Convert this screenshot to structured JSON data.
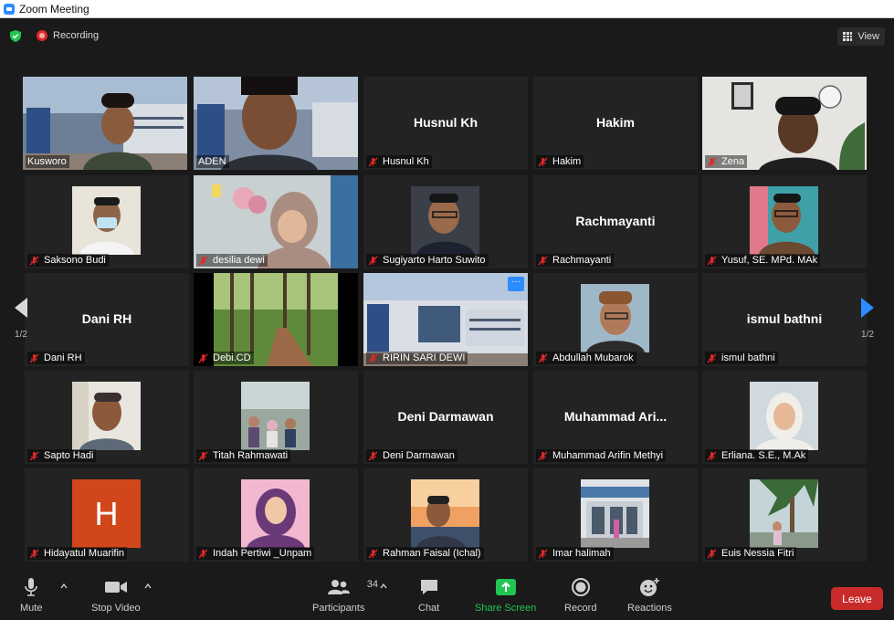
{
  "window": {
    "title": "Zoom Meeting"
  },
  "topbar": {
    "recording_label": "Recording",
    "view_label": "View"
  },
  "gallery": {
    "page_left": "1/2",
    "page_right": "1/2",
    "tiles": [
      {
        "name": "Kusworo",
        "big": ""
      },
      {
        "name": "ADEN",
        "big": ""
      },
      {
        "name": "Husnul Kh",
        "big": "Husnul Kh"
      },
      {
        "name": "Hakim",
        "big": "Hakim"
      },
      {
        "name": "Zena",
        "big": ""
      },
      {
        "name": "Saksono Budi",
        "big": ""
      },
      {
        "name": "desilia dewi",
        "big": ""
      },
      {
        "name": "Sugiyarto Harto Suwito",
        "big": ""
      },
      {
        "name": "Rachmayanti",
        "big": "Rachmayanti"
      },
      {
        "name": "Yusuf, SE. MPd. MAk",
        "big": ""
      },
      {
        "name": "Dani RH",
        "big": "Dani RH"
      },
      {
        "name": "Debi.CD",
        "big": ""
      },
      {
        "name": "RIRIN SARI DEWI",
        "big": ""
      },
      {
        "name": "Abdullah Mubarok",
        "big": ""
      },
      {
        "name": "ismul bathni",
        "big": "ismul bathni"
      },
      {
        "name": "Sapto Hadi",
        "big": ""
      },
      {
        "name": "Titah Rahmawati",
        "big": ""
      },
      {
        "name": "Deni Darmawan",
        "big": "Deni Darmawan"
      },
      {
        "name": "Muhammad Arifin Methyi",
        "big": "Muhammad  Ari..."
      },
      {
        "name": "Erliana. S.E., M.Ak",
        "big": ""
      },
      {
        "name": "Hidayatul Muarifin",
        "big": "",
        "avatar_letter": "H"
      },
      {
        "name": "Indah Pertiwi _Unpam",
        "big": ""
      },
      {
        "name": "Rahman Faisal (Ichal)",
        "big": ""
      },
      {
        "name": "Imar halimah",
        "big": ""
      },
      {
        "name": "Euis Nessia Fitri",
        "big": ""
      }
    ]
  },
  "toolbar": {
    "mute": "Mute",
    "stop_video": "Stop Video",
    "participants": "Participants",
    "participants_count": "34",
    "chat": "Chat",
    "share_screen": "Share Screen",
    "record": "Record",
    "reactions": "Reactions",
    "leave": "Leave"
  },
  "colors": {
    "active_speaker": "#c8e46a",
    "share_green": "#23c552",
    "leave_red": "#c92b2b",
    "muted_red": "#e02828",
    "avatar_orange": "#d1461b"
  }
}
